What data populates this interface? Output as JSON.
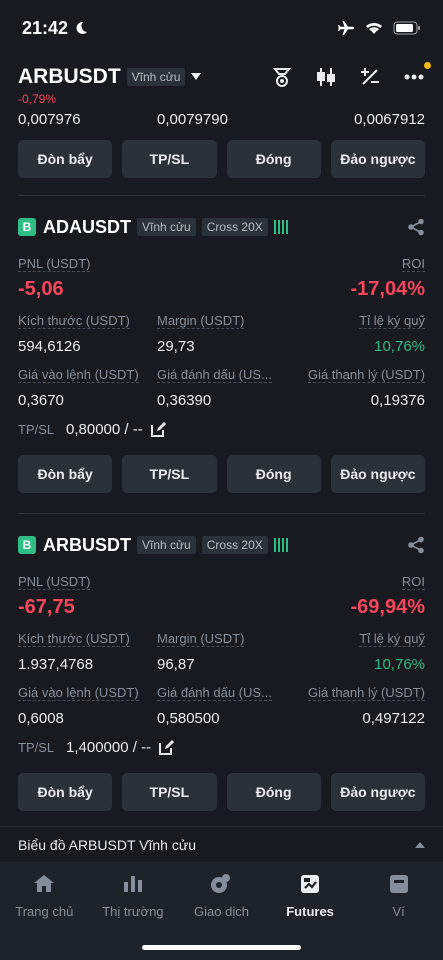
{
  "status": {
    "time": "21:42"
  },
  "header": {
    "symbol": "ARBUSDT",
    "tag": "Vĩnh cửu",
    "change": "-0,79%"
  },
  "top_cut": {
    "values": [
      "0,007976",
      "0,0079790",
      "0,0067912"
    ]
  },
  "buttons": {
    "leverage": "Đòn bẩy",
    "tpsl": "TP/SL",
    "close": "Đóng",
    "reverse": "Đảo ngược"
  },
  "positions": [
    {
      "badge": "B",
      "symbol": "ADAUSDT",
      "tag_perp": "Vĩnh cửu",
      "tag_margin": "Cross 20X",
      "pnl_label": "PNL (USDT)",
      "pnl": "-5,06",
      "roi_label": "ROI",
      "roi": "-17,04%",
      "size_label": "Kích thước (USDT)",
      "size": "594,6126",
      "margin_label": "Margin (USDT)",
      "margin": "29,73",
      "ratio_label": "Tỉ lệ ký quỹ",
      "ratio": "10,76%",
      "entry_label": "Giá vào lệnh (USDT)",
      "entry": "0,3670",
      "mark_label": "Giá đánh dấu (US...",
      "mark": "0,36390",
      "liq_label": "Giá thanh lý (USDT)",
      "liq": "0,19376",
      "tpsl_label": "TP/SL",
      "tpsl": "0,80000 / --"
    },
    {
      "badge": "B",
      "symbol": "ARBUSDT",
      "tag_perp": "Vĩnh cửu",
      "tag_margin": "Cross 20X",
      "pnl_label": "PNL (USDT)",
      "pnl": "-67,75",
      "roi_label": "ROI",
      "roi": "-69,94%",
      "size_label": "Kích thước (USDT)",
      "size": "1.937,4768",
      "margin_label": "Margin (USDT)",
      "margin": "96,87",
      "ratio_label": "Tỉ lệ ký quỹ",
      "ratio": "10,76%",
      "entry_label": "Giá vào lệnh (USDT)",
      "entry": "0,6008",
      "mark_label": "Giá đánh dấu (US...",
      "mark": "0,580500",
      "liq_label": "Giá thanh lý (USDT)",
      "liq": "0,497122",
      "tpsl_label": "TP/SL",
      "tpsl": "1,400000 / --"
    }
  ],
  "chart_bar": {
    "label": "Biểu đồ ARBUSDT Vĩnh cửu"
  },
  "nav": {
    "items": [
      "Trang chủ",
      "Thị trường",
      "Giao dịch",
      "Futures",
      "Ví"
    ]
  },
  "colors": {
    "up": "#2EBD85",
    "down": "#F6465D",
    "accent": "#F0B90B"
  }
}
